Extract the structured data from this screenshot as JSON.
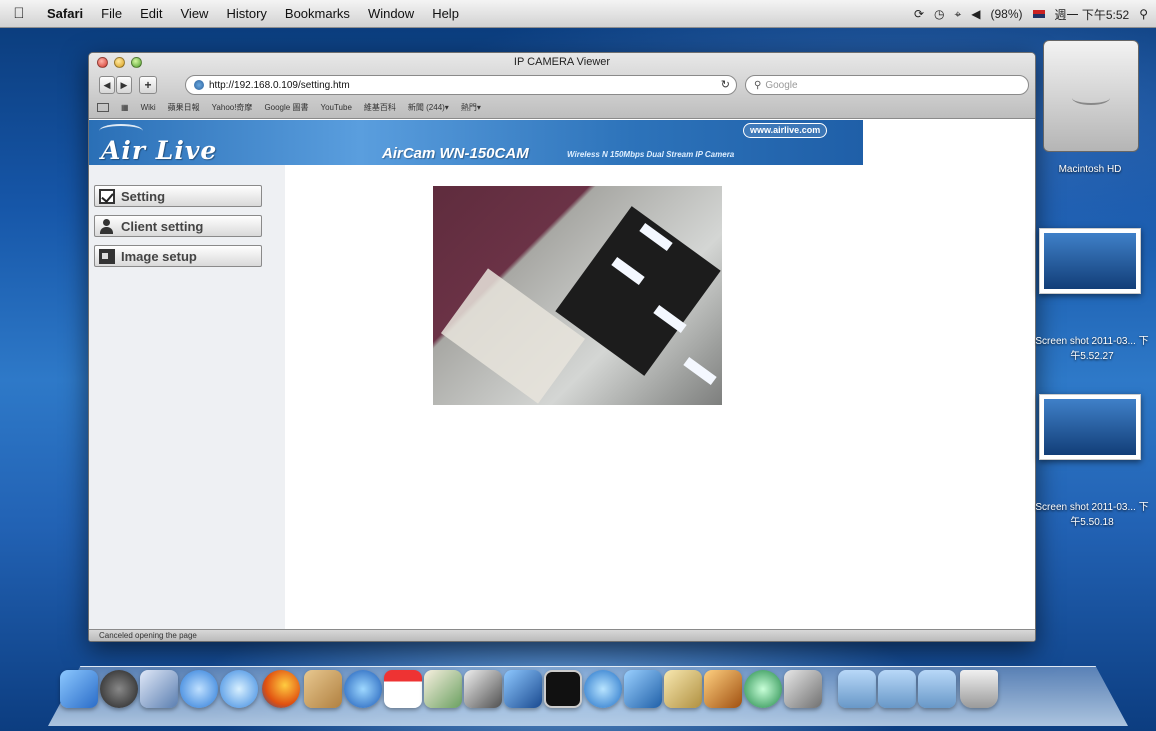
{
  "menubar": {
    "apple_icon": "apple-icon",
    "app": "Safari",
    "items": [
      "File",
      "Edit",
      "View",
      "History",
      "Bookmarks",
      "Window",
      "Help"
    ],
    "battery": "(98%)",
    "clock": "週一 下午5:52"
  },
  "window": {
    "title": "IP CAMERA Viewer",
    "url": "http://192.168.0.109/setting.htm",
    "search_placeholder": "Google",
    "bookmarks": [
      "Wiki",
      "蘋果日報",
      "Yahoo!奇摩",
      "Google 圖書",
      "YouTube",
      "維基百科",
      "新聞 (244)▾",
      "熱門▾"
    ],
    "status": "Canceled opening the page"
  },
  "page": {
    "logo": "Air Live",
    "website": "www.airlive.com",
    "product": "AirCam WN-150CAM",
    "product_sub": "Wireless N 150Mbps Dual Stream IP Camera",
    "menu": {
      "setting": "Setting",
      "client_setting": "Client setting",
      "image_setup": "Image setup"
    }
  },
  "desktop": {
    "hd_label": "Macintosh HD",
    "shot1_label": "Screen shot 2011-03... 下午5.52.27",
    "shot2_label": "Screen shot 2011-03... 下午5.50.18"
  },
  "colors": {
    "banner_blue": "#2d73ba",
    "desktop_blue": "#1656a8"
  }
}
